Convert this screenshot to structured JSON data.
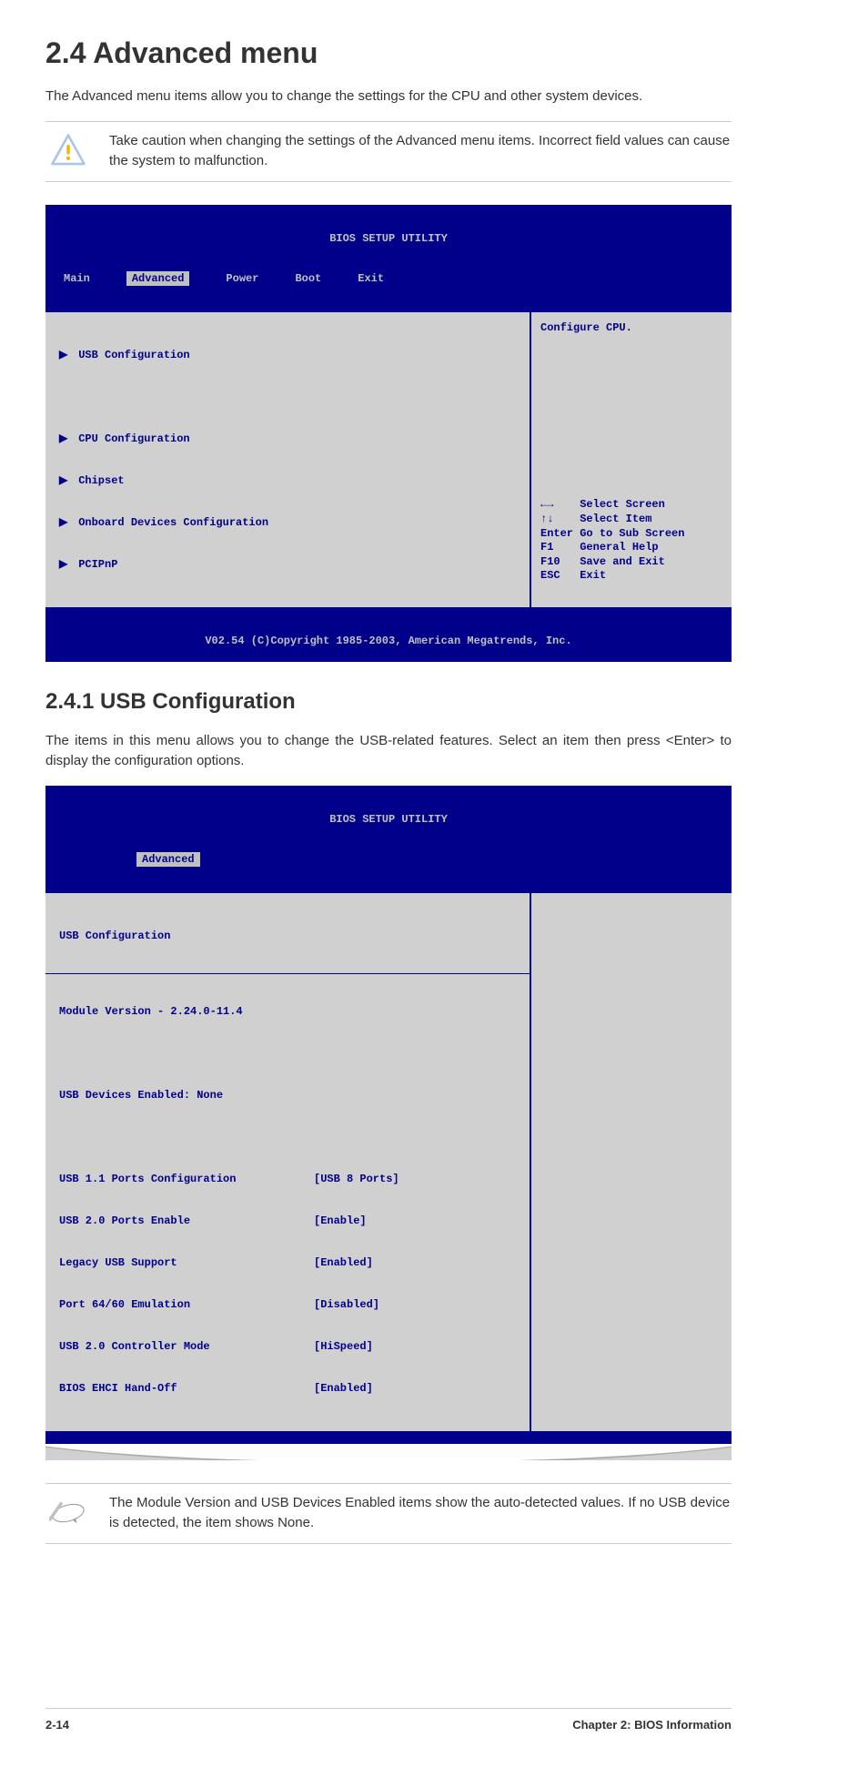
{
  "h1": "2.4   Advanced menu",
  "intro": "The Advanced menu items allow you to change the settings for the CPU and other system devices.",
  "warning": "Take caution when changing the settings of the Advanced menu items. Incorrect field values can cause the system to malfunction.",
  "bios1": {
    "title": "BIOS SETUP UTILITY",
    "tabs": {
      "main": "Main",
      "advanced": "Advanced",
      "power": "Power",
      "boot": "Boot",
      "exit": "Exit"
    },
    "menu": {
      "usb": "USB Configuration",
      "cpu": "CPU Configuration",
      "chipset": "Chipset",
      "onboard": "Onboard Devices Configuration",
      "pcipnp": "PCIPnP"
    },
    "help_top": "Configure CPU.",
    "help_keys": {
      "lr": "Select Screen",
      "ud": "Select Item",
      "enter_k": "Enter",
      "enter_v": "Go to Sub Screen",
      "f1_k": "F1",
      "f1_v": "General Help",
      "f10_k": "F10",
      "f10_v": "Save and Exit",
      "esc_k": "ESC",
      "esc_v": "Exit"
    },
    "footer": "V02.54 (C)Copyright 1985-2003, American Megatrends, Inc."
  },
  "h2": "2.4.1   USB Configuration",
  "usb_intro": "The items in this menu allows you to change the USB-related features. Select an item then press <Enter> to display the configuration options.",
  "bios2": {
    "title": "BIOS SETUP UTILITY",
    "tab": "Advanced",
    "header": "USB Configuration",
    "module": "Module Version - 2.24.0-11.4",
    "devices": "USB Devices Enabled: None",
    "settings": [
      {
        "label": "USB 1.1 Ports Configuration",
        "value": "[USB 8 Ports]"
      },
      {
        "label": "USB 2.0 Ports Enable",
        "value": "[Enable]"
      },
      {
        "label": "Legacy USB Support",
        "value": "[Enabled]"
      },
      {
        "label": "Port 64/60 Emulation",
        "value": "[Disabled]"
      },
      {
        "label": "USB 2.0 Controller Mode",
        "value": "[HiSpeed]"
      },
      {
        "label": "BIOS EHCI Hand-Off",
        "value": "[Enabled]"
      }
    ]
  },
  "note": "The Module Version and USB Devices Enabled items show the auto-detected values. If no USB device is detected, the item shows None.",
  "footer": {
    "page": "2-14",
    "chapter": "Chapter 2: BIOS Information"
  }
}
